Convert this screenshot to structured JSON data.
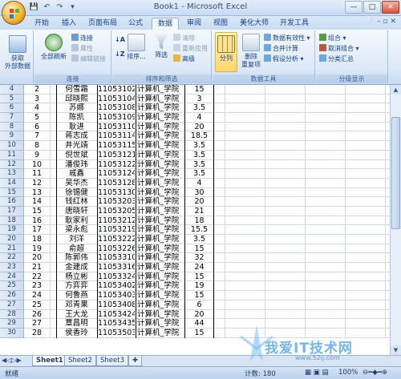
{
  "window": {
    "title": "Book1 - Microsoft Excel",
    "controls": [
      "—",
      "□",
      "✕"
    ]
  },
  "qat": [
    "💾",
    "↶",
    "↷",
    "▾"
  ],
  "tabs": [
    "开始",
    "插入",
    "页面布局",
    "公式",
    "数据",
    "审阅",
    "视图",
    "美化大师",
    "开发工具"
  ],
  "active_tab": "数据",
  "ribbon": {
    "get_external": "获取\n外部数据",
    "refresh_all": "全部刷新",
    "conn": [
      "连接",
      "属性",
      "编辑链接"
    ],
    "conn_label": "连接",
    "sort_asc": "↓A",
    "sort_desc": "↓Z",
    "sort": "排序...",
    "filter": "筛选",
    "filter_small": [
      "清除",
      "重新应用",
      "高级"
    ],
    "sort_label": "排序和筛选",
    "split": "分列",
    "remove_dup": "删除\n重复项",
    "data_tools_small": [
      "数据有效性 ▾",
      "合并计算",
      "假设分析 ▾"
    ],
    "data_tools_label": "数据工具",
    "outline_small": [
      "组合 ▾",
      "取消组合 ▾",
      "分类汇总"
    ],
    "outline_label": "分级显示"
  },
  "rows": [
    {
      "r": "4",
      "n": "2",
      "name": "何雪霜",
      "id": "11053102",
      "dept": "计算机_学院",
      "v": "15"
    },
    {
      "r": "5",
      "n": "3",
      "name": "邱晓熙",
      "id": "11053104",
      "dept": "计算机_学院",
      "v": "3"
    },
    {
      "r": "6",
      "n": "4",
      "name": "苏娜",
      "id": "11053108",
      "dept": "计算机_学院",
      "v": "3.5"
    },
    {
      "r": "7",
      "n": "5",
      "name": "陈凯",
      "id": "11053109",
      "dept": "计算机_学院",
      "v": "4"
    },
    {
      "r": "8",
      "n": "6",
      "name": "耿进",
      "id": "11053110",
      "dept": "计算机_学院",
      "v": "20"
    },
    {
      "r": "9",
      "n": "7",
      "name": "蒋志成",
      "id": "11053114",
      "dept": "计算机_学院",
      "v": "18.5"
    },
    {
      "r": "10",
      "n": "8",
      "name": "井光靖",
      "id": "11053115",
      "dept": "计算机_学院",
      "v": "3.5"
    },
    {
      "r": "11",
      "n": "9",
      "name": "倪世斌",
      "id": "11053121",
      "dept": "计算机_学院",
      "v": "3.5"
    },
    {
      "r": "12",
      "n": "10",
      "name": "潘俊玮",
      "id": "11053122",
      "dept": "计算机_学院",
      "v": "3.5"
    },
    {
      "r": "13",
      "n": "11",
      "name": "戚鑫",
      "id": "11053124",
      "dept": "计算机_学院",
      "v": "3.5"
    },
    {
      "r": "14",
      "n": "12",
      "name": "吴华杰",
      "id": "11053128",
      "dept": "计算机_学院",
      "v": "4"
    },
    {
      "r": "15",
      "n": "13",
      "name": "徐锡健",
      "id": "11053130",
      "dept": "计算机_学院",
      "v": "30"
    },
    {
      "r": "16",
      "n": "14",
      "name": "钱红林",
      "id": "11053203",
      "dept": "计算机_学院",
      "v": "20"
    },
    {
      "r": "17",
      "n": "15",
      "name": "唐晓轩",
      "id": "11053205",
      "dept": "计算机_学院",
      "v": "21"
    },
    {
      "r": "18",
      "n": "16",
      "name": "耿家利",
      "id": "11053212",
      "dept": "计算机_学院",
      "v": "18"
    },
    {
      "r": "19",
      "n": "17",
      "name": "梁永彪",
      "id": "11053219",
      "dept": "计算机_学院",
      "v": "15.5"
    },
    {
      "r": "20",
      "n": "18",
      "name": "刘洋",
      "id": "11053222",
      "dept": "计算机_学院",
      "v": "3.5"
    },
    {
      "r": "21",
      "n": "19",
      "name": "俞超",
      "id": "11053226",
      "dept": "计算机_学院",
      "v": "15"
    },
    {
      "r": "22",
      "n": "20",
      "name": "陈郭伟",
      "id": "11053310",
      "dept": "计算机_学院",
      "v": "32"
    },
    {
      "r": "23",
      "n": "21",
      "name": "金建成",
      "id": "11053316",
      "dept": "计算机_学院",
      "v": "24"
    },
    {
      "r": "24",
      "n": "22",
      "name": "杨立彬",
      "id": "11053324",
      "dept": "计算机_学院",
      "v": "15"
    },
    {
      "r": "25",
      "n": "23",
      "name": "方弈弈",
      "id": "11053402",
      "dept": "计算机_学院",
      "v": "19"
    },
    {
      "r": "26",
      "n": "24",
      "name": "何鲁燕",
      "id": "11053403",
      "dept": "计算机_学院",
      "v": "15"
    },
    {
      "r": "27",
      "n": "25",
      "name": "邓青果",
      "id": "11053408",
      "dept": "计算机_学院",
      "v": "6"
    },
    {
      "r": "28",
      "n": "26",
      "name": "王大龙",
      "id": "11053424",
      "dept": "计算机_学院",
      "v": "20"
    },
    {
      "r": "29",
      "n": "27",
      "name": "覃昌明",
      "id": "11053435",
      "dept": "计算机_学院",
      "v": "44"
    },
    {
      "r": "30",
      "n": "28",
      "name": "侯香玲",
      "id": "11053503",
      "dept": "计算机_学院",
      "v": "15"
    }
  ],
  "sheets": [
    "Sheet1",
    "Sheet2",
    "Sheet3"
  ],
  "active_sheet": "Sheet1",
  "status": {
    "mode": "就绪",
    "count": "计数: 180",
    "zoom": "100%"
  },
  "watermark": {
    "text": "我爱IT技术网",
    "url": "www.52ij.com"
  }
}
